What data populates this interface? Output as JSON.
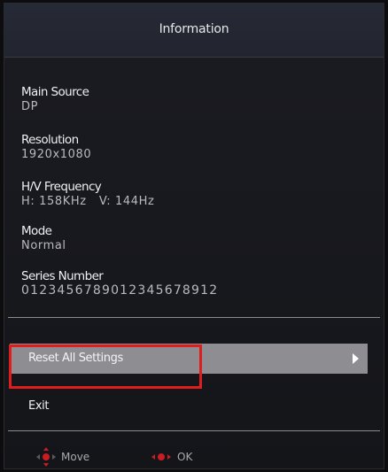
{
  "title": "Information",
  "fields": {
    "main_source": {
      "label": "Main Source",
      "value": "DP"
    },
    "resolution": {
      "label": "Resolution",
      "value": "1920x1080"
    },
    "frequency": {
      "label": "H/V Frequency",
      "value": "H: 158KHz   V: 144Hz"
    },
    "mode": {
      "label": "Mode",
      "value": "Normal"
    },
    "series": {
      "label": "Series Number",
      "value": "01234567890123456789​12"
    }
  },
  "menu": {
    "reset": "Reset All Settings",
    "exit": "Exit"
  },
  "footer": {
    "move": "Move",
    "ok": "OK"
  },
  "colors": {
    "selected_row": "#8d8d92",
    "highlight": "#e01d1d",
    "dpad_accent": "#c81d24"
  },
  "icons": {
    "submenu": "chevron-right-icon",
    "move": "dpad-move-icon",
    "ok": "dpad-ok-icon"
  }
}
